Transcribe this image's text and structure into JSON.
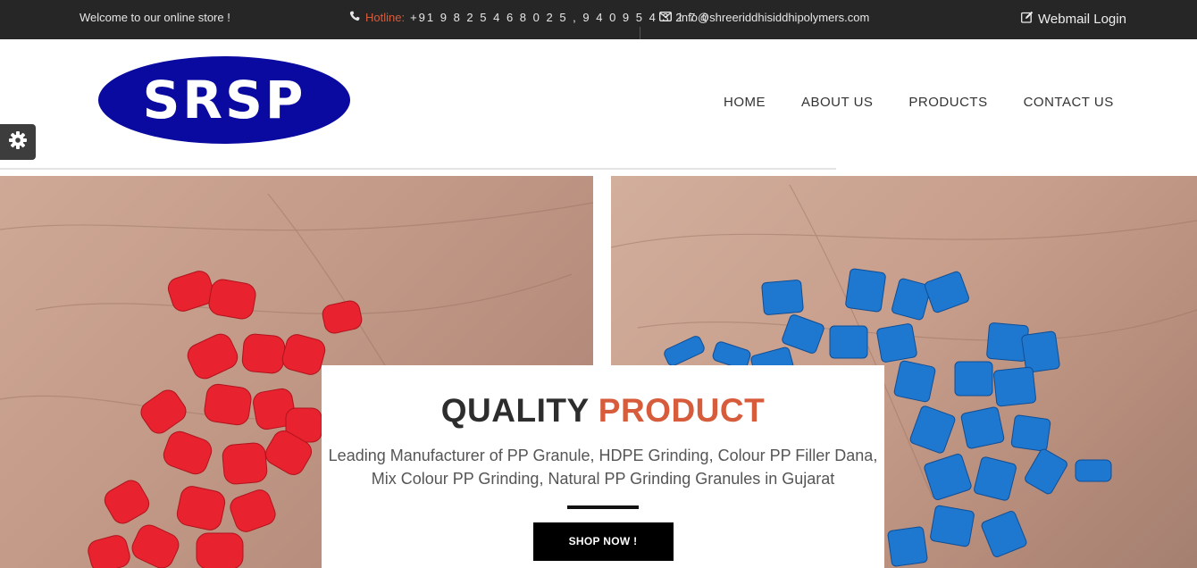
{
  "topbar": {
    "welcome": "Welcome to our online store !",
    "hotline_label": "Hotline:",
    "hotline_numbers": "+91 9 8 2 5 4 6 8 0 2 5 , 9 4 0 9 5 4 3 2 7 0",
    "email": "info@shreeriddhisiddhipolymers.com",
    "webmail": "Webmail Login"
  },
  "header": {
    "logo_text": "SRSP",
    "nav": [
      "HOME",
      "ABOUT US",
      "PRODUCTS",
      "CONTACT US"
    ]
  },
  "hero": {
    "title_main": "QUALITY",
    "title_accent": "PRODUCT",
    "description": "Leading Manufacturer of PP Granule, HDPE Grinding, Colour PP Filler Dana, Mix Colour PP Grinding, Natural PP Grinding Granules in Gujarat",
    "button": "SHOP NOW !"
  },
  "colors": {
    "accent": "#d75c3c",
    "topbar_bg": "#262626",
    "logo_blue": "#0a0aa0",
    "granule_red": "#e8222e",
    "granule_blue": "#1e78d0"
  },
  "icons": [
    "phone-icon",
    "envelope-icon",
    "edit-icon",
    "gear-icon"
  ]
}
